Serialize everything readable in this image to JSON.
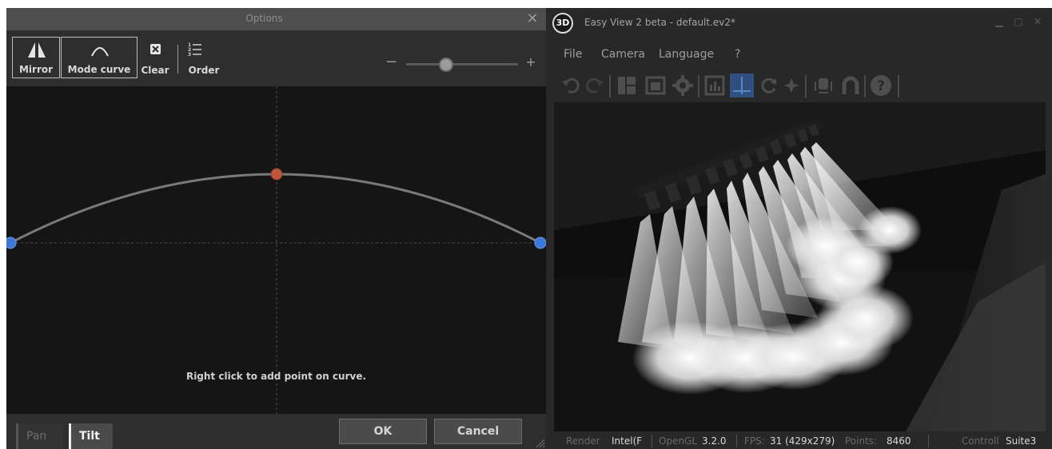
{
  "options_dialog": {
    "title": "Options",
    "close_glyph": "×",
    "toolbar": {
      "mirror_label": "Mirror",
      "mode_curve_label": "Mode curve",
      "clear_label": "Clear",
      "order_label": "Order"
    },
    "zoom": {
      "minus": "−",
      "plus": "+",
      "level": 0.4
    },
    "hint": "Right click to add point on curve.",
    "tabs": {
      "pan": "Pan",
      "tilt": "Tilt",
      "active": "Tilt"
    },
    "ok_label": "OK",
    "cancel_label": "Cancel",
    "colors": {
      "endpoint": "#3b78d8",
      "midpoint": "#c0553a",
      "curve": "#7a7a7a"
    }
  },
  "easy_view": {
    "title": "Easy View 2 beta - default.ev2*",
    "logo_text": "3D",
    "menu": [
      "File",
      "Camera",
      "Language",
      "?"
    ],
    "toolbar_icons": [
      "undo-icon",
      "redo-icon",
      "layout-icon",
      "window-icon",
      "settings-icon",
      "chart-icon",
      "axes-icon",
      "refresh-icon",
      "star-icon",
      "fixture-icon",
      "magnet-icon",
      "help-icon"
    ],
    "status": {
      "render_label": "Render",
      "render_value": "Intel(F",
      "opengl_label": "OpenGL",
      "opengl_value": "3.2.0",
      "fps_label": "FPS:",
      "fps_value": "31 (429x279)",
      "points_label": "Points:",
      "points_value": "8460",
      "controller_label": "Controll",
      "controller_value": "Suite3"
    }
  }
}
